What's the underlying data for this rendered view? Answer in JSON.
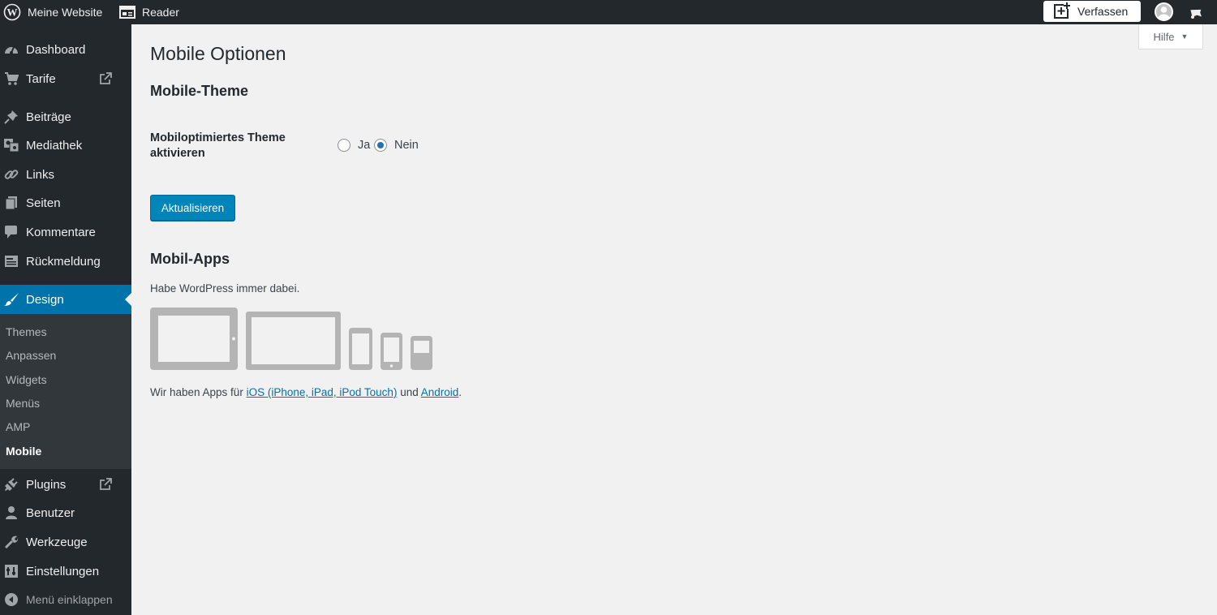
{
  "adminbar": {
    "site_name": "Meine Website",
    "reader_label": "Reader",
    "compose_label": "Verfassen"
  },
  "help": {
    "label": "Hilfe"
  },
  "sidebar": {
    "items": [
      {
        "id": "dashboard",
        "label": "Dashboard",
        "icon": "dashboard-icon"
      },
      {
        "id": "tarife",
        "label": "Tarife",
        "icon": "cart-icon"
      },
      {
        "id": "beitraege",
        "label": "Beiträge",
        "icon": "pin-icon"
      },
      {
        "id": "mediathek",
        "label": "Mediathek",
        "icon": "media-icon"
      },
      {
        "id": "links",
        "label": "Links",
        "icon": "link-icon"
      },
      {
        "id": "seiten",
        "label": "Seiten",
        "icon": "pages-icon"
      },
      {
        "id": "kommentare",
        "label": "Kommentare",
        "icon": "comment-icon"
      },
      {
        "id": "rueckmeldung",
        "label": "Rückmeldung",
        "icon": "feedback-icon"
      },
      {
        "id": "design",
        "label": "Design",
        "icon": "brush-icon"
      },
      {
        "id": "plugins",
        "label": "Plugins",
        "icon": "plugin-icon"
      },
      {
        "id": "benutzer",
        "label": "Benutzer",
        "icon": "user-icon"
      },
      {
        "id": "werkzeuge",
        "label": "Werkzeuge",
        "icon": "wrench-icon"
      },
      {
        "id": "einstellungen",
        "label": "Einstellungen",
        "icon": "settings-icon"
      }
    ],
    "submenu": [
      {
        "label": "Themes"
      },
      {
        "label": "Anpassen"
      },
      {
        "label": "Widgets"
      },
      {
        "label": "Menüs"
      },
      {
        "label": "AMP"
      },
      {
        "label": "Mobile"
      }
    ],
    "collapse_label": "Menü einklappen"
  },
  "main": {
    "title": "Mobile Optionen",
    "theme_section": "Mobile-Theme",
    "theme_setting_label": "Mobiloptimiertes Theme aktivieren",
    "options": {
      "yes": "Ja",
      "no": "Nein",
      "selected": "Nein"
    },
    "update_button": "Aktualisieren",
    "apps_section": "Mobil-Apps",
    "apps_description": "Habe WordPress immer dabei.",
    "apps_line_prefix": "Wir haben Apps für",
    "ios_link": "iOS (iPhone, iPad, iPod Touch)",
    "apps_line_mid": "und",
    "android_link": "Android",
    "apps_line_suffix": "."
  },
  "colors": {
    "adminbar_bg": "#23282d",
    "sidebar_bg": "#23282d",
    "submenu_bg": "#32373c",
    "accent": "#0073aa",
    "button": "#0085ba",
    "content_bg": "#f1f1f1"
  }
}
